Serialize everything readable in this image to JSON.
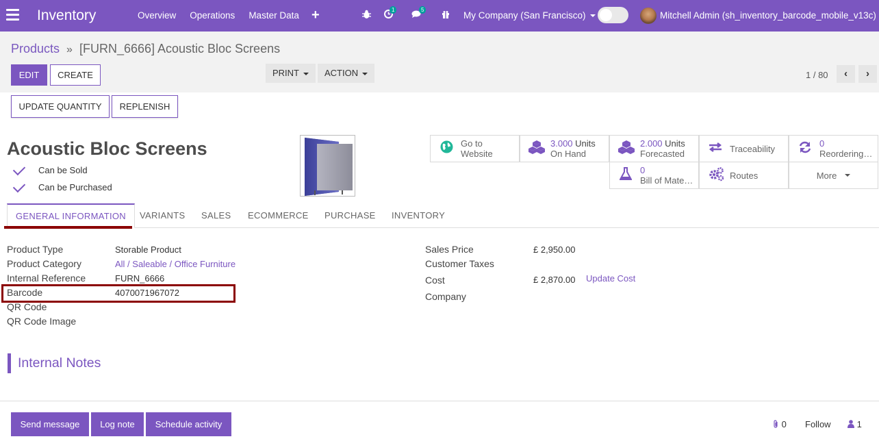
{
  "navbar": {
    "app_name": "Inventory",
    "menu": [
      "Overview",
      "Operations",
      "Master Data"
    ],
    "plus": "+",
    "activity_count": "1",
    "message_count": "5",
    "company": "My Company (San Francisco)",
    "user": "Mitchell Admin (sh_inventory_barcode_mobile_v13c)"
  },
  "breadcrumb": {
    "parent": "Products",
    "separator": "»",
    "current": "[FURN_6666] Acoustic Bloc Screens"
  },
  "toolbar": {
    "edit": "EDIT",
    "create": "CREATE",
    "print": "PRINT",
    "action": "ACTION",
    "pager": "1 / 80",
    "prev": "‹",
    "next": "›"
  },
  "header_buttons": {
    "update_quantity": "UPDATE QUANTITY",
    "replenish": "REPLENISH"
  },
  "product": {
    "name": "Acoustic Bloc Screens",
    "can_be_sold": "Can be Sold",
    "can_be_purchased": "Can be Purchased"
  },
  "smart_buttons": {
    "website": {
      "line1": "Go to",
      "line2": "Website"
    },
    "on_hand": {
      "value": "3.000",
      "unit": "Units",
      "label": "On Hand"
    },
    "forecasted": {
      "value": "2.000",
      "unit": "Units",
      "label": "Forecasted"
    },
    "traceability": {
      "label": "Traceability"
    },
    "reordering": {
      "value": "0",
      "label": "Reordering…"
    },
    "bom": {
      "value": "0",
      "label": "Bill of Mate…"
    },
    "routes": {
      "label": "Routes"
    },
    "more": {
      "label": "More"
    }
  },
  "tabs": [
    "GENERAL INFORMATION",
    "VARIANTS",
    "SALES",
    "ECOMMERCE",
    "PURCHASE",
    "INVENTORY"
  ],
  "general": {
    "product_type_label": "Product Type",
    "product_type": "Storable Product",
    "category_label": "Product Category",
    "category": "All / Saleable / Office Furniture",
    "internal_ref_label": "Internal Reference",
    "internal_ref": "FURN_6666",
    "barcode_label": "Barcode",
    "barcode": "4070071967072",
    "qr_code_label": "QR Code",
    "qr_image_label": "QR Code Image",
    "sales_price_label": "Sales Price",
    "sales_price": "£ 2,950.00",
    "customer_taxes_label": "Customer Taxes",
    "cost_label": "Cost",
    "cost": "£ 2,870.00",
    "update_cost": "Update Cost",
    "company_label": "Company"
  },
  "notes": {
    "title": "Internal Notes"
  },
  "chatter": {
    "send_message": "Send message",
    "log_note": "Log note",
    "schedule_activity": "Schedule activity",
    "attachments": "0",
    "follow": "Follow",
    "followers": "1"
  },
  "colors": {
    "brand": "#7b56c0",
    "highlight": "#8b0000"
  }
}
